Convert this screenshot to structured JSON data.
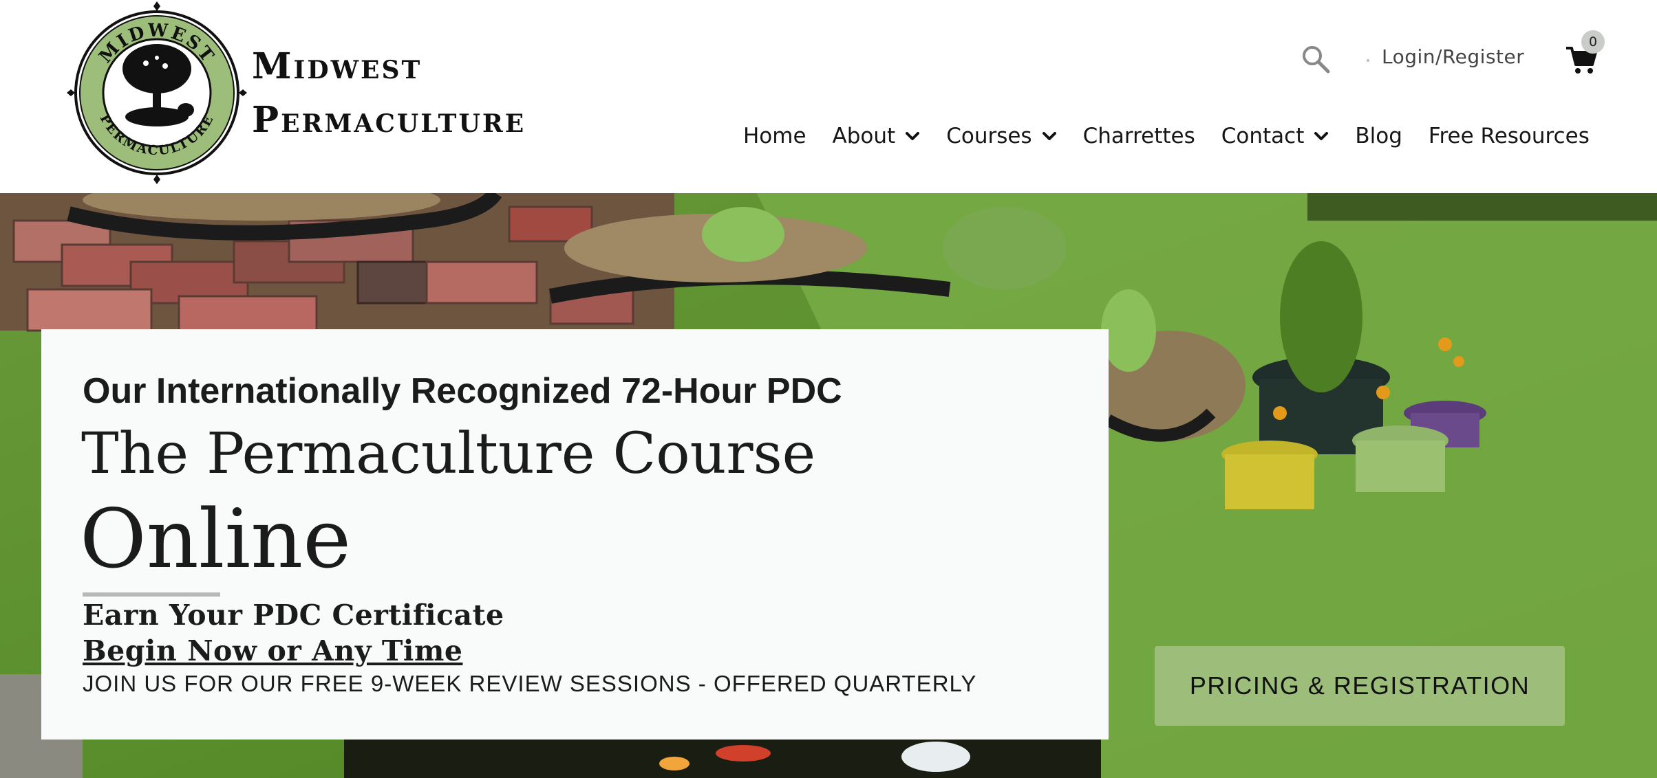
{
  "brand": {
    "logo_arc_top": "MIDWEST",
    "logo_arc_bottom": "PERMACULTURE",
    "name_line1": "Midwest",
    "name_line2": "Permaculture"
  },
  "utility": {
    "search_icon": "search-icon",
    "login_label": "Login/Register",
    "cart_icon": "cart-icon",
    "cart_count": "0"
  },
  "nav": {
    "items": [
      {
        "label": "Home",
        "has_dropdown": false
      },
      {
        "label": "About",
        "has_dropdown": true
      },
      {
        "label": "Courses",
        "has_dropdown": true
      },
      {
        "label": "Charrettes",
        "has_dropdown": false
      },
      {
        "label": "Contact",
        "has_dropdown": true
      },
      {
        "label": "Blog",
        "has_dropdown": false
      },
      {
        "label": "Free Resources",
        "has_dropdown": false
      }
    ]
  },
  "hero": {
    "eyebrow": "Our Internationally Recognized 72-Hour PDC",
    "title": "The Permaculture Course",
    "title_big": "Online",
    "line1": "Earn Your PDC Certificate",
    "line2": "Begin Now or Any Time",
    "line3": "JOIN US FOR OUR FREE 9-WEEK REVIEW SESSIONS - OFFERED QUARTERLY",
    "cta_label": "PRICING & REGISTRATION"
  },
  "colors": {
    "accent_green": "#9dbd7a",
    "logo_ring_green": "#9dbd7a",
    "card_bg": "#f8fbfa",
    "text": "#1b1b1b"
  }
}
